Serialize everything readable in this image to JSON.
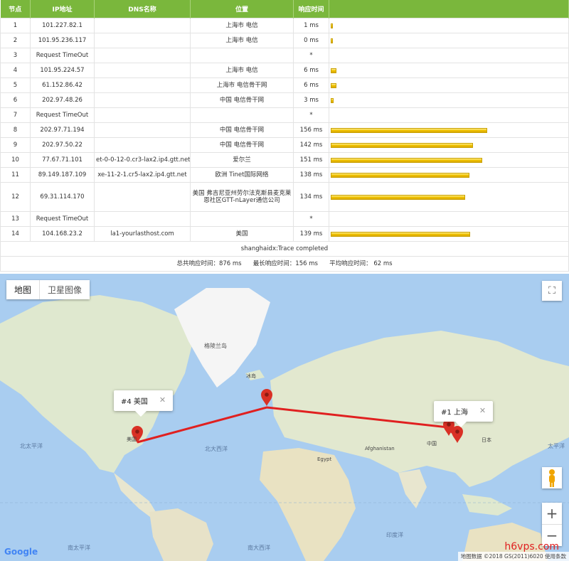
{
  "table": {
    "headers": [
      "节点",
      "IP地址",
      "DNS名称",
      "位置",
      "响应时间",
      ""
    ],
    "rows": [
      {
        "hop": "1",
        "ip": "101.227.82.1",
        "dns": "",
        "loc": "上海市 电信",
        "time": "1 ms",
        "ms": 1
      },
      {
        "hop": "2",
        "ip": "101.95.236.117",
        "dns": "",
        "loc": "上海市 电信",
        "time": "0 ms",
        "ms": 0
      },
      {
        "hop": "3",
        "ip": "Request TimeOut",
        "dns": "",
        "loc": "",
        "time": "*",
        "ms": 0
      },
      {
        "hop": "4",
        "ip": "101.95.224.57",
        "dns": "",
        "loc": "上海市 电信",
        "time": "6 ms",
        "ms": 6
      },
      {
        "hop": "5",
        "ip": "61.152.86.42",
        "dns": "",
        "loc": "上海市 电信骨干网",
        "time": "6 ms",
        "ms": 6
      },
      {
        "hop": "6",
        "ip": "202.97.48.26",
        "dns": "",
        "loc": "中国 电信骨干网",
        "time": "3 ms",
        "ms": 3
      },
      {
        "hop": "7",
        "ip": "Request TimeOut",
        "dns": "",
        "loc": "",
        "time": "*",
        "ms": 0
      },
      {
        "hop": "8",
        "ip": "202.97.71.194",
        "dns": "",
        "loc": "中国 电信骨干网",
        "time": "156 ms",
        "ms": 156
      },
      {
        "hop": "9",
        "ip": "202.97.50.22",
        "dns": "",
        "loc": "中国 电信骨干网",
        "time": "142 ms",
        "ms": 142
      },
      {
        "hop": "10",
        "ip": "77.67.71.101",
        "dns": "et-0-0-12-0.cr3-lax2.ip4.gtt.net",
        "loc": "爱尔兰",
        "time": "151 ms",
        "ms": 151
      },
      {
        "hop": "11",
        "ip": "89.149.187.109",
        "dns": "xe-11-2-1.cr5-lax2.ip4.gtt.net",
        "loc": "欧洲 Tinet国际网络",
        "time": "138 ms",
        "ms": 138
      },
      {
        "hop": "12",
        "ip": "69.31.114.170",
        "dns": "",
        "loc": "美国 弗吉尼亚州劳尔法克斯县麦克莱恩社区GTT-nLayer通信公司",
        "time": "134 ms",
        "ms": 134
      },
      {
        "hop": "13",
        "ip": "Request TimeOut",
        "dns": "",
        "loc": "",
        "time": "*",
        "ms": 0
      },
      {
        "hop": "14",
        "ip": "104.168.23.2",
        "dns": "la1-yourlasthost.com",
        "loc": "美国",
        "time": "139 ms",
        "ms": 139
      }
    ],
    "max_ms": 156,
    "complete_text": "shanghaidx:Trace completed",
    "summary_text": "总共响应时间：876 ms      最长响应时间：156 ms      平均响应时间： 62 ms"
  },
  "map": {
    "maptype_map": "地图",
    "maptype_satellite": "卫星图像",
    "fullscreen_icon": "⛶",
    "zoom_in": "+",
    "zoom_out": "−",
    "info_us": "#4 美国",
    "info_sh": "#1 上海",
    "close": "✕",
    "logo": "Google",
    "attribution": "地图数据 ©2018 GS(2011)6020  使用条款",
    "watermark": "h6vps.com",
    "route_color": "#e02020",
    "labels": {
      "greenland": "格陵兰岛",
      "north_pacific": "北太平洋",
      "north_atlantic": "北大西洋",
      "south_pacific": "南太平洋",
      "south_atlantic": "南大西洋",
      "indian_ocean": "印度洋",
      "japan": "日本",
      "china": "中国",
      "usa": "美国",
      "iceland": "冰岛",
      "egypt": "Egypt",
      "afghanistan": "Afghanistan",
      "pacific": "太平洋"
    }
  }
}
